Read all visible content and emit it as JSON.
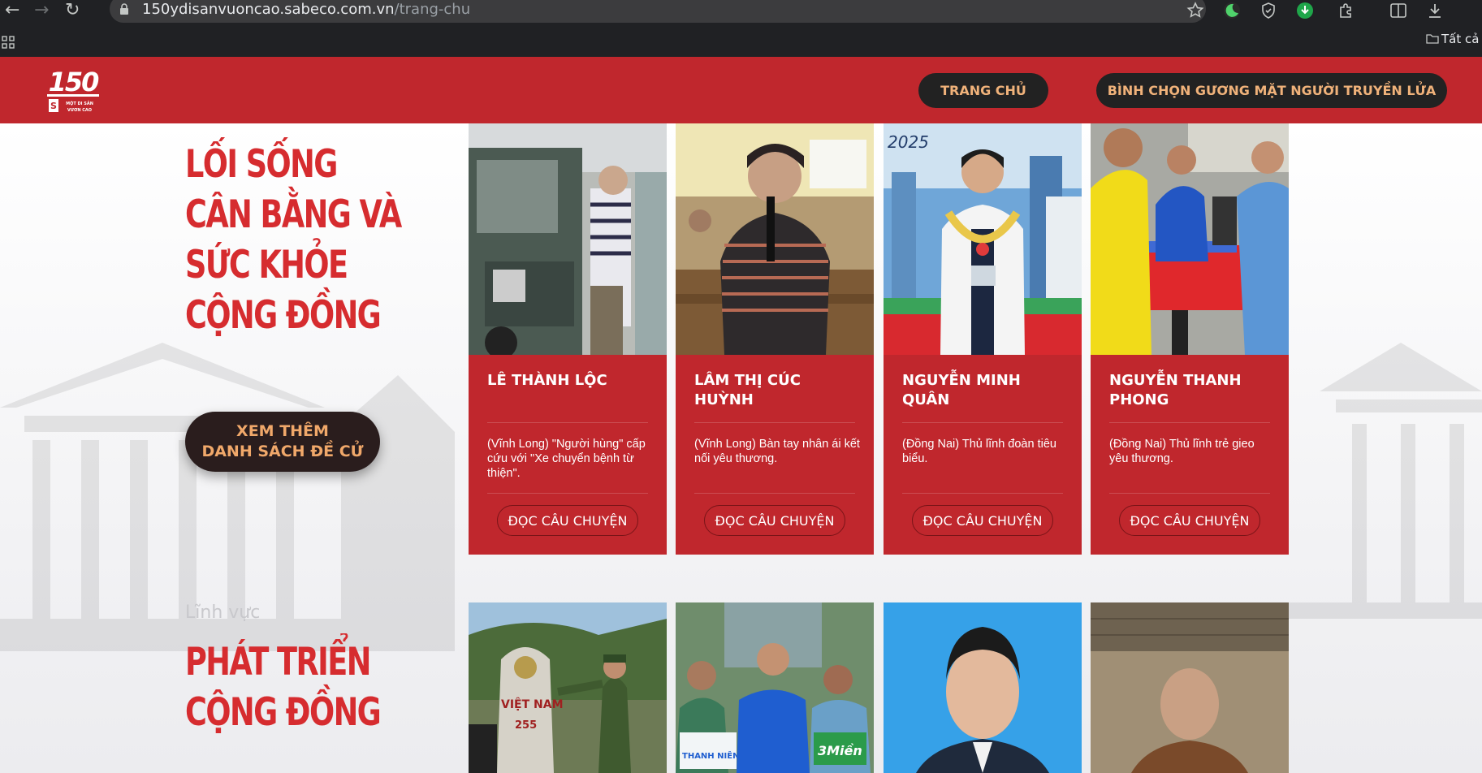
{
  "browser": {
    "url_host": "150ydisanvuoncao.sabeco.com.vn",
    "url_path": "/trang-chu",
    "bookmarks_all": "Tất cả"
  },
  "header": {
    "logo_text": "150",
    "logo_sub": "MỘT DI SẢN VƯƠN CAO",
    "nav": [
      {
        "label": "TRANG CHỦ"
      },
      {
        "label": "BÌNH CHỌN GƯƠNG MẶT NGƯỜI TRUYỀN LỬA"
      }
    ]
  },
  "section1": {
    "title_lines": [
      "LỐI SỐNG",
      "CÂN BẰNG VÀ",
      "SỨC KHỎE",
      "CỘNG ĐỒNG"
    ],
    "more_button": [
      "XEM THÊM",
      "DANH SÁCH ĐỀ CỬ"
    ]
  },
  "cards": [
    {
      "name": "LÊ THÀNH LỘC",
      "desc": "(Vĩnh Long) \"Người hùng\" cấp cứu với \"Xe chuyển bệnh từ thiện\".",
      "button": "ĐỌC CÂU CHUYỆN"
    },
    {
      "name": "LÂM THỊ CÚC HUỲNH",
      "desc": "(Vĩnh Long) Bàn tay nhân ái kết nối yêu thương.",
      "button": "ĐỌC CÂU CHUYỆN"
    },
    {
      "name": "NGUYỄN MINH QUÂN",
      "desc": "(Đồng Nai) Thủ lĩnh đoàn tiêu biểu.",
      "button": "ĐỌC CÂU CHUYỆN"
    },
    {
      "name": "NGUYỄN THANH PHONG",
      "desc": "(Đồng Nai) Thủ lĩnh trẻ gieo yêu thương.",
      "button": "ĐỌC CÂU CHUYỆN"
    }
  ],
  "section2": {
    "label": "Lĩnh vực",
    "title_lines": [
      "PHÁT TRIỂN",
      "CỘNG ĐỒNG"
    ]
  },
  "photo_captions": {
    "border_marker_country": "VIỆT NAM",
    "border_marker_number": "255",
    "sign_thanh_nien": "THANH NIÊN",
    "sign_3mien": "3Miền",
    "banner_year": "2025"
  }
}
